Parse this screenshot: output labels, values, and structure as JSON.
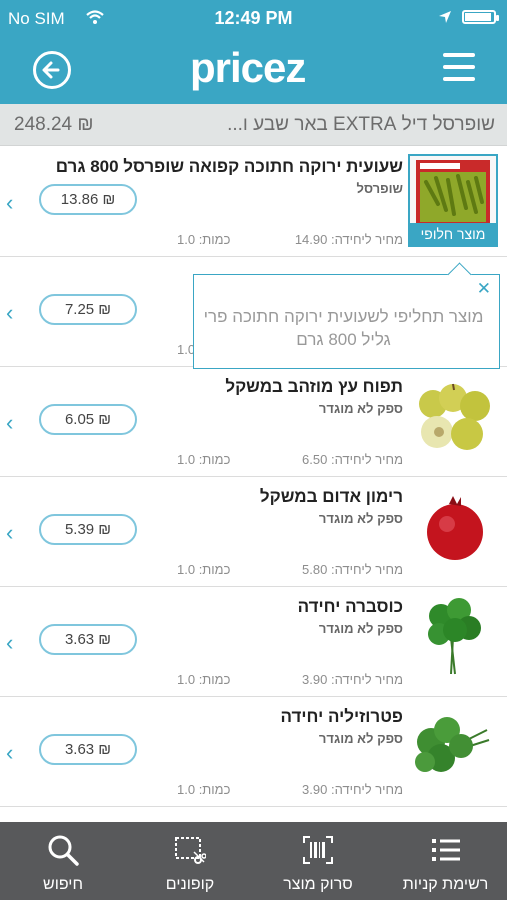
{
  "status": {
    "carrier": "No SIM",
    "time": "12:49 PM"
  },
  "header": {
    "logo": "pricez"
  },
  "store": {
    "name": "שופרסל דיל EXTRA באר שבע ו...",
    "total": "248.24 ₪"
  },
  "items": [
    {
      "name": "שעועית ירוקה חתוכה קפואה שופרסל 800 גרם",
      "brand": "שופרסל",
      "unit_price": "מחיר ליחידה: 14.90",
      "qty": "כמות: 1.0",
      "price": "13.86 ₪",
      "badge": "מוצר חלופי"
    },
    {
      "name": "",
      "brand": "",
      "unit_price": "",
      "qty": "1.0",
      "price": "7.25 ₪"
    },
    {
      "name": "תפוח עץ מוזהב במשקל",
      "brand": "ספק לא מוגדר",
      "unit_price": "מחיר ליחידה: 6.50",
      "qty": "כמות: 1.0",
      "price": "6.05 ₪"
    },
    {
      "name": "רימון אדום במשקל",
      "brand": "ספק לא מוגדר",
      "unit_price": "מחיר ליחידה: 5.80",
      "qty": "כמות: 1.0",
      "price": "5.39 ₪"
    },
    {
      "name": "כוסברה יחידה",
      "brand": "ספק לא מוגדר",
      "unit_price": "מחיר ליחידה: 3.90",
      "qty": "כמות: 1.0",
      "price": "3.63 ₪"
    },
    {
      "name": "פטרוזיליה יחידה",
      "brand": "ספק לא מוגדר",
      "unit_price": "מחיר ליחידה: 3.90",
      "qty": "כמות: 1.0",
      "price": "3.63 ₪"
    }
  ],
  "tooltip": {
    "text": "מוצר תחליפי לשעועית ירוקה חתוכה פרי גליל 800 גרם"
  },
  "tabs": [
    {
      "label": "רשימת קניות",
      "icon": "list-icon"
    },
    {
      "label": "סרוק מוצר",
      "icon": "barcode-icon"
    },
    {
      "label": "קופונים",
      "icon": "coupon-scissors-icon"
    },
    {
      "label": "חיפוש",
      "icon": "search-icon"
    }
  ],
  "colors": {
    "accent": "#3aa6c4",
    "tabbar": "#58595b",
    "storebar": "#e1e4e4"
  }
}
